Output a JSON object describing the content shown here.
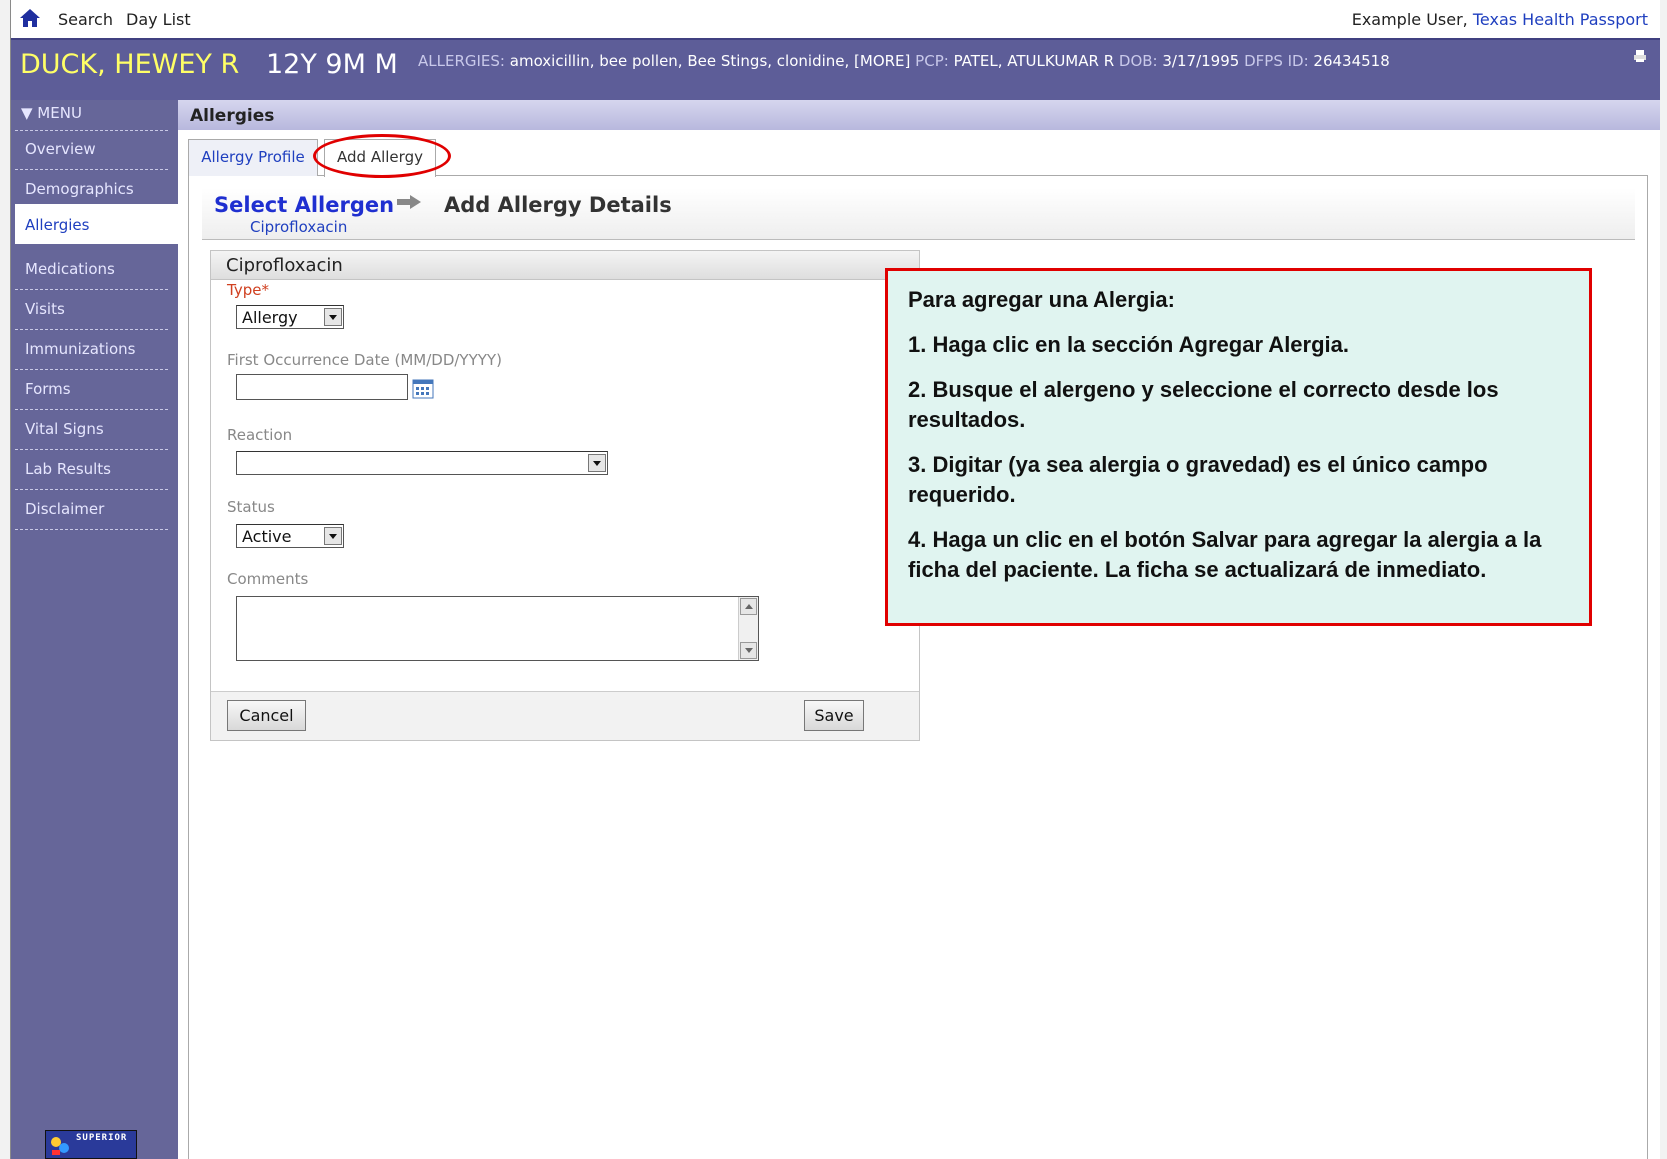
{
  "topbar": {
    "search": "Search",
    "daylist": "Day List",
    "user": "Example User,",
    "org": "Texas Health Passport"
  },
  "patient": {
    "name": "DUCK, HEWEY R",
    "age_sex": "12Y 9M  M",
    "allergies_label": "ALLERGIES:",
    "allergies_value": "amoxicillin, bee pollen, Bee Stings, clonidine, [MORE]",
    "pcp_label": "PCP:",
    "pcp_value": "PATEL, ATULKUMAR R",
    "dob_label": "DOB:",
    "dob_value": "3/17/1995",
    "dfps_label": "DFPS ID:",
    "dfps_value": "26434518"
  },
  "sidebar": {
    "menu": "▼ MENU",
    "items": [
      {
        "label": "Overview"
      },
      {
        "label": "Demographics"
      },
      {
        "label": "Allergies"
      },
      {
        "label": "Medications"
      },
      {
        "label": "Visits"
      },
      {
        "label": "Immunizations"
      },
      {
        "label": "Forms"
      },
      {
        "label": "Vital Signs"
      },
      {
        "label": "Lab Results"
      },
      {
        "label": "Disclaimer"
      }
    ],
    "logo": "SUPERIOR"
  },
  "section": {
    "title": "Allergies"
  },
  "tabs": [
    {
      "label": "Allergy Profile"
    },
    {
      "label": "Add Allergy"
    }
  ],
  "wizard": {
    "step1": "Select Allergen",
    "step2": "Add Allergy Details",
    "selected": "Ciprofloxacin"
  },
  "form": {
    "title": "Ciprofloxacin",
    "type_label": "Type*",
    "type_value": "Allergy",
    "date_label": "First Occurrence Date (MM/DD/YYYY)",
    "date_value": "",
    "reaction_label": "Reaction",
    "reaction_value": "",
    "status_label": "Status",
    "status_value": "Active",
    "comments_label": "Comments",
    "comments_value": "",
    "cancel": "Cancel",
    "save": "Save"
  },
  "instructions": {
    "heading": "Para agregar una Alergia:",
    "steps": [
      "1.  Haga clic  en la sección Agregar Alergia.",
      "2.  Busque el alergeno y seleccione el correcto desde los resultados.",
      "3.  Digitar (ya sea alergia o gravedad) es el único campo requerido.",
      "4.  Haga un clic en el botón Salvar para agregar la alergia a la ficha del paciente.  La ficha se actualizará de inmediato."
    ]
  },
  "colors": {
    "sidebar": "#666699",
    "patient_bar": "#5d5d98",
    "link": "#1f3fbf",
    "highlight": "#e00000",
    "instruction_bg": "#e0f4f0"
  }
}
